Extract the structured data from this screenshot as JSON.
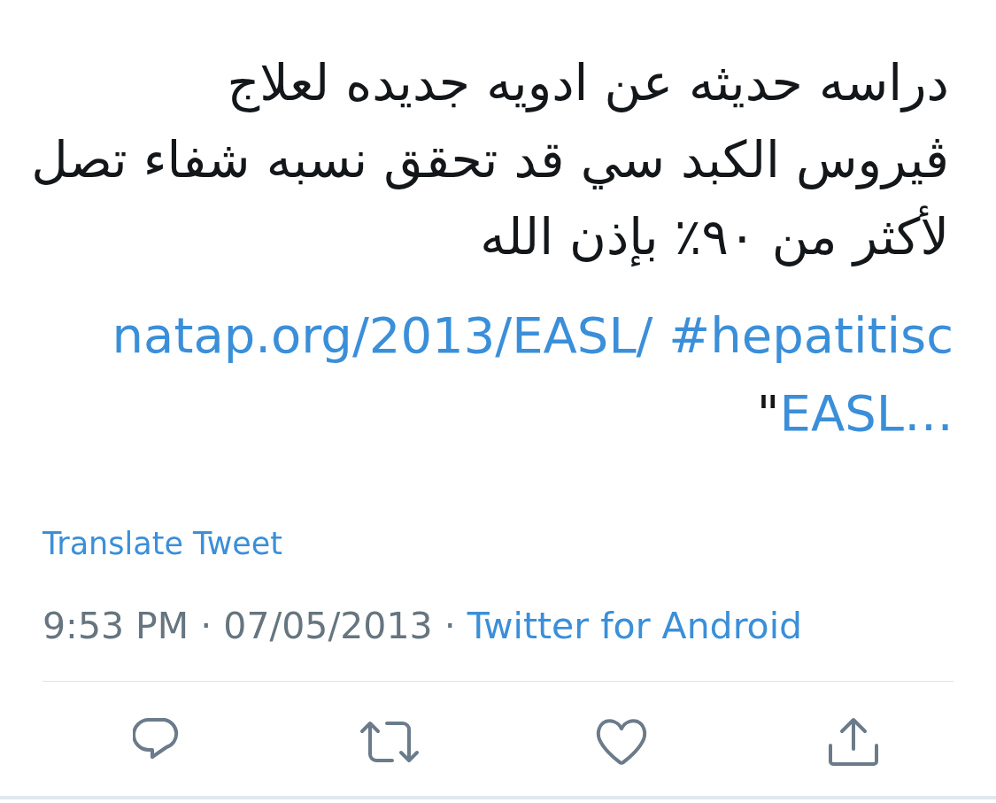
{
  "tweet": {
    "text": "دراسه حديثه عن ادويه جديده لعلاج\nڤيروس الكبد سي قد تحقق نسبه شفاء تصل\nلأكثر من ٩٠٪ بإذن الله",
    "link_line": {
      "url": "natap.org/2013/EASL/",
      "hashtag": "#hepatitisc"
    },
    "quoted_line": {
      "quote": "\"",
      "link": "EASL…"
    },
    "translate": "Translate Tweet",
    "timestamp": "9:53 PM · 07/05/2013 ·",
    "source": "Twitter for Android",
    "actions": [
      {
        "kind": "reply"
      },
      {
        "kind": "retweet"
      },
      {
        "kind": "like"
      },
      {
        "kind": "share"
      }
    ]
  }
}
